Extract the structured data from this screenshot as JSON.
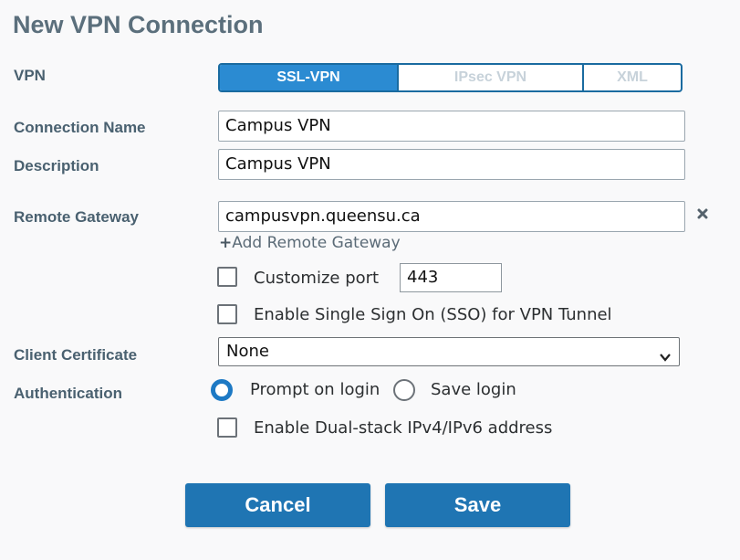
{
  "title": "New VPN Connection",
  "vpn": {
    "label": "VPN",
    "options": [
      "SSL-VPN",
      "IPsec VPN",
      "XML"
    ],
    "selected": "SSL-VPN"
  },
  "connection_name": {
    "label": "Connection Name",
    "value": "Campus VPN"
  },
  "description": {
    "label": "Description",
    "value": "Campus VPN"
  },
  "remote_gateway": {
    "label": "Remote Gateway",
    "value": "campusvpn.queensu.ca",
    "add_label": "Add Remote Gateway"
  },
  "customize_port": {
    "label": "Customize port",
    "checked": false,
    "value": "443"
  },
  "sso": {
    "label": "Enable Single Sign On (SSO) for VPN Tunnel",
    "checked": false
  },
  "client_certificate": {
    "label": "Client Certificate",
    "selected": "None"
  },
  "authentication": {
    "label": "Authentication",
    "options": [
      "Prompt on login",
      "Save login"
    ],
    "selected": "Prompt on login"
  },
  "dual_stack": {
    "label": "Enable Dual-stack IPv4/IPv6 address",
    "checked": false
  },
  "buttons": {
    "cancel": "Cancel",
    "save": "Save"
  },
  "colors": {
    "accent": "#1f75b3",
    "segment_active": "#2b8bd2",
    "label": "#4a6170"
  }
}
